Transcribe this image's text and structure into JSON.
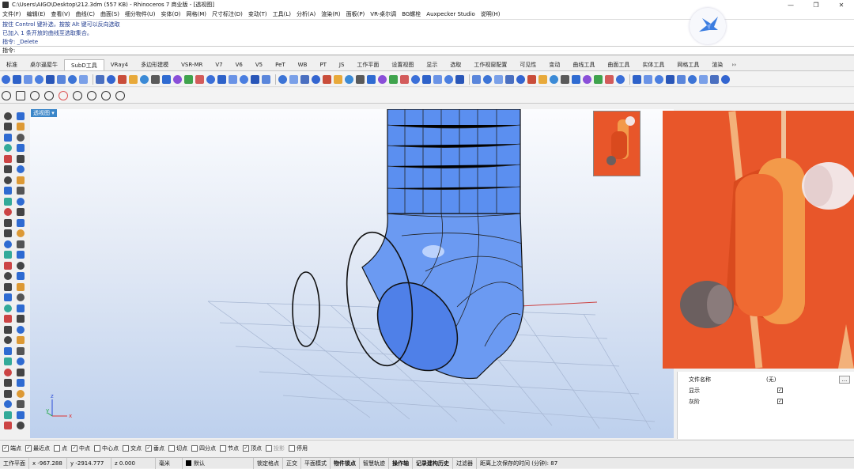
{
  "window": {
    "title": "C:\\Users\\AIGO\\Desktop\\212.3dm (557 KB) - Rhinoceros 7 商业版 - [透视图]",
    "controls": [
      "—",
      "❐",
      "✕"
    ]
  },
  "menu": [
    "文件(F)",
    "编辑(E)",
    "查看(V)",
    "曲线(C)",
    "曲面(S)",
    "细分物件(U)",
    "实体(O)",
    "网格(M)",
    "尺寸标注(D)",
    "变动(T)",
    "工具(L)",
    "分析(A)",
    "渲染(R)",
    "面板(P)",
    "VR-桌尔调",
    "BG螺栓",
    "Auxpecker Studio",
    "说明(H)"
  ],
  "command_history": [
    "按住 Control 键补选，按按 Alt 键可以反向选取",
    "已加入 1 条开放的曲线至选取集合。",
    "指令: _Delete"
  ],
  "command_prompt": {
    "label": "指令:",
    "value": ""
  },
  "tabs": {
    "items": [
      "标准",
      "桌尔逼屋牛",
      "SubD工具",
      "VRay4",
      "多边形建模",
      "VSR-MR",
      "V7",
      "V6",
      "V5",
      "PeT",
      "WB",
      "PT",
      "JS",
      "工作平面",
      "设置视图",
      "显示",
      "选取",
      "工作视窗配置",
      "可见性",
      "变动",
      "曲线工具",
      "曲面工具",
      "实体工具",
      "网格工具",
      "渲染"
    ],
    "active_index": 2,
    "overflow": "››"
  },
  "toolbar_icon_colors": [
    "#3b6fd8",
    "#2e62c9",
    "#6a93e6",
    "#4a7ee0",
    "#2956b8",
    "#5a86db",
    "#3c74d6",
    "#7aa0e8",
    "#4a6fc0",
    "#3365d0",
    "#c94d3a",
    "#e8a93a",
    "#3b8ad6",
    "#5a5a5a",
    "#2f6bd1",
    "#8a4fd8",
    "#3fa34d",
    "#d35b5b"
  ],
  "viewport": {
    "label": "透视图",
    "label_arrow": "▾",
    "axis_x": "x",
    "axis_y": "y",
    "axis_z": "z",
    "object_color": "#5a8ff0"
  },
  "properties": {
    "rows": [
      {
        "label": "文件名称",
        "value": "(无)",
        "button": "..."
      },
      {
        "label": "显示",
        "checked": true
      },
      {
        "label": "灰阶",
        "checked": true
      }
    ]
  },
  "osnap": [
    {
      "label": "端点",
      "checked": true
    },
    {
      "label": "最近点",
      "checked": true
    },
    {
      "label": "点",
      "checked": false
    },
    {
      "label": "中点",
      "checked": true
    },
    {
      "label": "中心点",
      "checked": false
    },
    {
      "label": "交点",
      "checked": false
    },
    {
      "label": "垂点",
      "checked": true
    },
    {
      "label": "切点",
      "checked": false
    },
    {
      "label": "四分点",
      "checked": false
    },
    {
      "label": "节点",
      "checked": false
    },
    {
      "label": "顶点",
      "checked": true
    },
    {
      "label": "投影",
      "checked": false,
      "dim": true
    },
    {
      "label": "停用",
      "checked": false
    }
  ],
  "status": {
    "cplane": "工作平面",
    "x": "x -967.288",
    "y": "y -2914.777",
    "z": "z 0.000",
    "unit": "毫米",
    "layer": "默认",
    "toggles": [
      "锁定格点",
      "正交",
      "平面模式",
      "物件锁点",
      "智慧轨迹",
      "操作轴",
      "记录建构历史",
      "过滤器"
    ],
    "bold_toggles": [
      3,
      5,
      6
    ],
    "autosave": "距离上次保存的时间 (分钟): 87"
  },
  "photo": {
    "bg": "#e8562a",
    "body": "#ef6a32",
    "clip": "#f39a4a",
    "tip": "#f2e4e4",
    "dark": "#6b5f5f"
  }
}
